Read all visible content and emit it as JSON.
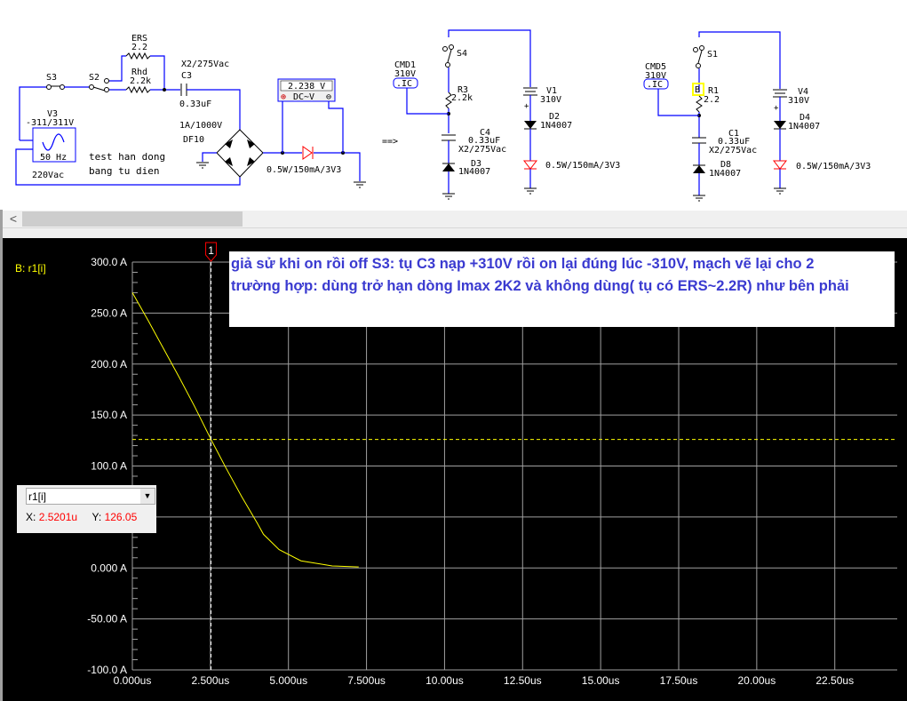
{
  "schematic": {
    "left": {
      "ers_name": "ERS",
      "ers_value": "2.2",
      "s3": "S3",
      "s2": "S2",
      "rhd_name": "Rhd",
      "rhd_value": "2.2k",
      "c3_rating": "X2/275Vac",
      "c3_name": "C3",
      "c3_value": "0.33uF",
      "v3_name": "V3",
      "v3_value": "-311/311V",
      "v3_freq": "50 Hz",
      "v3_rms": "220Vac",
      "bridge_rating": "1A/1000V",
      "bridge_name": "DF10",
      "note_line1": "test han dong",
      "note_line2": "bang tu dien",
      "meter_value": "2.238 V",
      "meter_mode": "DC~V",
      "led_rating": "0.5W/150mA/3V3"
    },
    "arrow": "==>",
    "middle": {
      "cmd": "CMD1",
      "cmd_value": "310V",
      "ic": ".IC",
      "switch": "S4",
      "r_name": "R3",
      "r_value": "2.2k",
      "c_name": "C4",
      "c_value": "0.33uF",
      "c_rating": "X2/275Vac",
      "d_name": "D3",
      "d_part": "1N4007",
      "v_name": "V1",
      "v_value": "310V",
      "d2_name": "D2",
      "d2_part": "1N4007",
      "led_rating": "0.5W/150mA/3V3"
    },
    "right": {
      "cmd": "CMD5",
      "cmd_value": "310V",
      "ic": ".IC",
      "switch": "S1",
      "probe": "B",
      "r_name": "R1",
      "r_value": "2.2",
      "c_name": "C1",
      "c_value": "0.33uF",
      "c_rating": "X2/275Vac",
      "d_name": "D8",
      "d_part": "1N4007",
      "v_name": "V4",
      "v_value": "310V",
      "d2_name": "D4",
      "d2_part": "1N4007",
      "led_rating": "0.5W/150mA/3V3"
    }
  },
  "scrollbar": {
    "left_arrow": "<"
  },
  "plot": {
    "trace_label": "B: r1[i]",
    "cursor_marker": "1",
    "annotation_line1": "giả sử khi on rồi off S3: tụ C3 nạp +310V rồi on lại đúng lúc -310V, mạch vẽ lại cho 2",
    "annotation_line2": "trường hợp: dùng trở hạn dòng Imax 2K2 và không dùng( tụ có ERS~2.2R) như bên phải",
    "readout": {
      "trace": "r1[i]",
      "x_label": "X:",
      "x_value": "2.5201u",
      "y_label": "Y:",
      "y_value": "126.05"
    }
  },
  "chart_data": {
    "type": "line",
    "background": "#000000",
    "grid": true,
    "trace_color": "#ffff00",
    "xlim": [
      0,
      24.5
    ],
    "ylim": [
      -100,
      300
    ],
    "x_ticks": [
      0,
      2.5,
      5,
      7.5,
      10,
      12.5,
      15,
      17.5,
      20,
      22.5
    ],
    "x_tick_labels": [
      "0.000us",
      "2.500us",
      "5.000us",
      "7.500us",
      "10.00us",
      "12.50us",
      "15.00us",
      "17.50us",
      "20.00us",
      "22.50us"
    ],
    "y_ticks": [
      300,
      250,
      200,
      150,
      100,
      50,
      0,
      -50,
      -100
    ],
    "y_tick_labels": [
      "300.0 A",
      "250.0 A",
      "200.0 A",
      "150.0 A",
      "100.0 A",
      "50.00 A",
      "0.000 A",
      "-50.00 A",
      "-100.0 A"
    ],
    "series": [
      {
        "name": "r1[i]",
        "x": [
          0,
          0.5,
          1,
          1.5,
          2,
          2.52,
          3,
          3.5,
          4,
          4.2,
          4.7,
          5.4,
          6.4,
          7.25
        ],
        "y": [
          270,
          243,
          215,
          187,
          158,
          126,
          98,
          70,
          44,
          33,
          18,
          7,
          2,
          1
        ]
      }
    ],
    "cursor": {
      "x": 2.5201,
      "y": 126.05
    }
  }
}
